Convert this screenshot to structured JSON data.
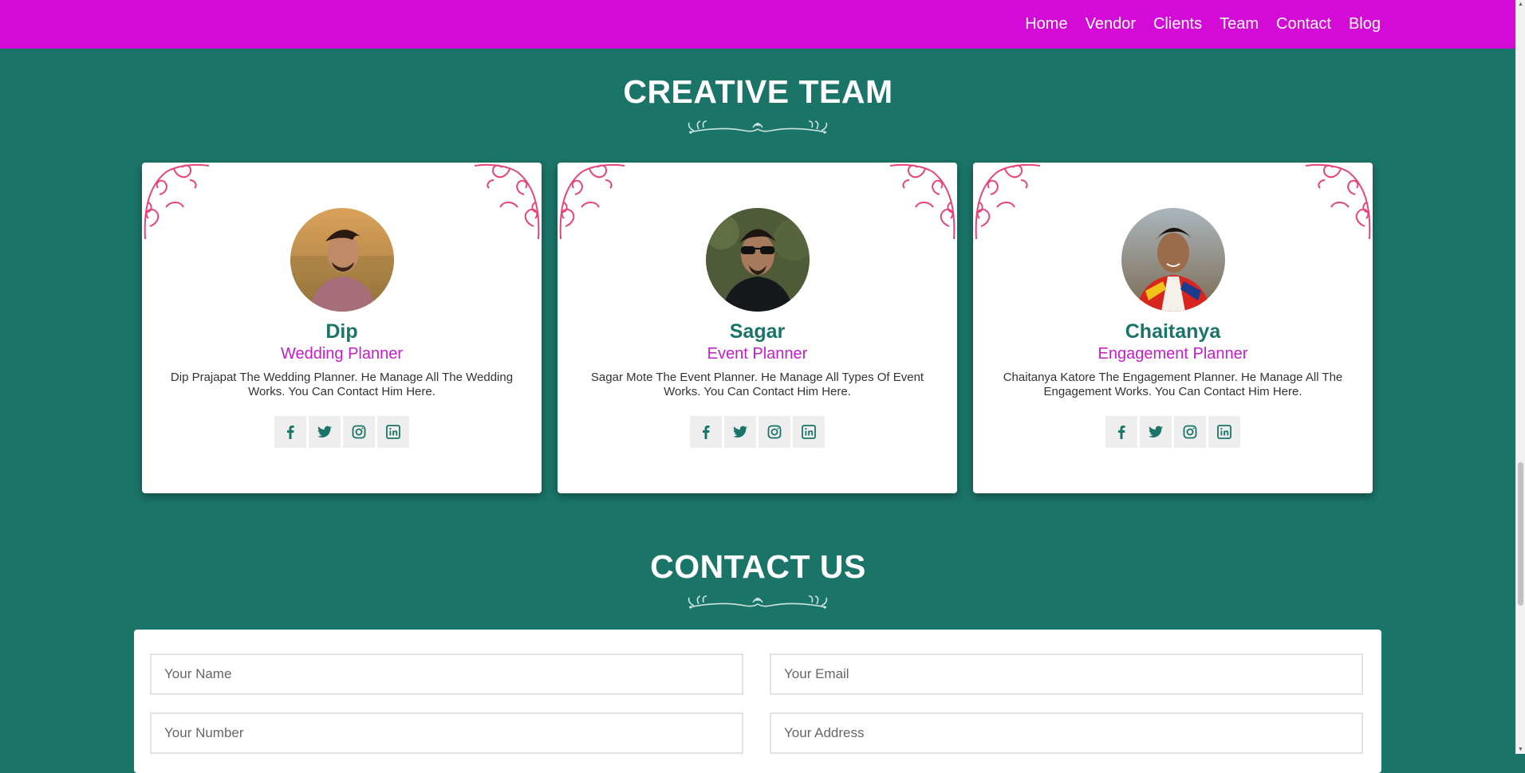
{
  "nav": {
    "items": [
      {
        "label": "Home"
      },
      {
        "label": "Vendor"
      },
      {
        "label": "Clients"
      },
      {
        "label": "Team"
      },
      {
        "label": "Contact"
      },
      {
        "label": "Blog"
      }
    ]
  },
  "team": {
    "title": "CREATIVE TEAM",
    "members": [
      {
        "name": "Dip",
        "role": "Wedding Planner",
        "desc": "Dip Prajapat The Wedding Planner. He Manage All The Wedding Works. You Can Contact Him Here."
      },
      {
        "name": "Sagar",
        "role": "Event Planner",
        "desc": "Sagar Mote The Event Planner. He Manage All Types Of Event Works. You Can Contact Him Here."
      },
      {
        "name": "Chaitanya",
        "role": "Engagement Planner",
        "desc": "Chaitanya Katore The Engagement Planner. He Manage All The Engagement Works. You Can Contact Him Here."
      }
    ],
    "social_icons": [
      "facebook-icon",
      "twitter-icon",
      "instagram-icon",
      "linkedin-icon"
    ]
  },
  "contact": {
    "title": "CONTACT US",
    "name_placeholder": "Your Name",
    "email_placeholder": "Your Email",
    "number_placeholder": "Your Number",
    "address_placeholder": "Your Address"
  },
  "colors": {
    "nav_bg": "#d40bd6",
    "page_bg": "#1b7468",
    "accent": "#c61cc9",
    "ornament": "#e8447a"
  }
}
